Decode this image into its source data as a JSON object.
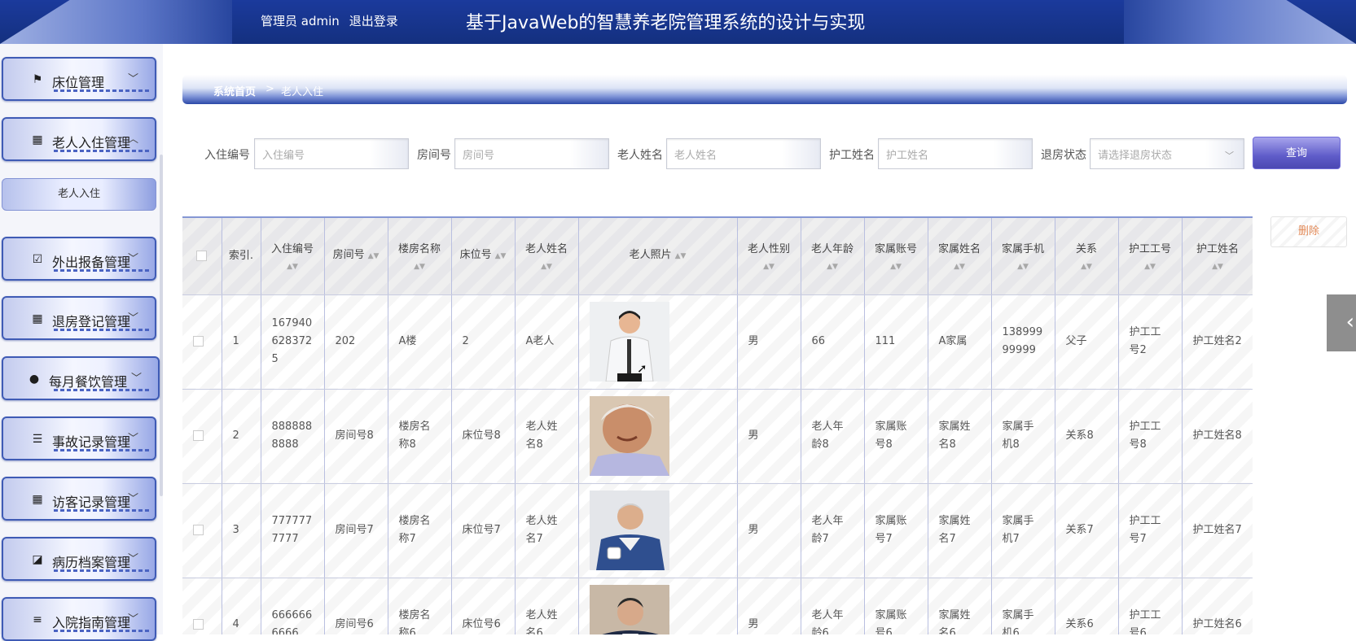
{
  "header": {
    "user_label": "管理员 admin",
    "logout": "退出登录",
    "title": "基于JavaWeb的智慧养老院管理系统的设计与实现"
  },
  "sidebar": {
    "menus": [
      {
        "label": "床位管理",
        "icon": "flag-icon",
        "chevron": "﹀"
      },
      {
        "label": "老人入住管理",
        "icon": "grid-icon",
        "chevron": "︿"
      },
      {
        "label": "外出报备管理",
        "icon": "clipboard-check-icon",
        "chevron": "﹀"
      },
      {
        "label": "退房登记管理",
        "icon": "grid-icon",
        "chevron": "﹀"
      },
      {
        "label": "每月餐饮管理",
        "icon": "lightbulb-icon",
        "chevron": "﹀"
      },
      {
        "label": "事故记录管理",
        "icon": "sliders-icon",
        "chevron": "﹀"
      },
      {
        "label": "访客记录管理",
        "icon": "grid-icon",
        "chevron": "﹀"
      },
      {
        "label": "病历档案管理",
        "icon": "chart-icon",
        "chevron": "﹀"
      },
      {
        "label": "入院指南管理",
        "icon": "list-icon",
        "chevron": "﹀"
      }
    ],
    "submenu": {
      "label": "老人入住"
    }
  },
  "breadcrumb": {
    "home": "系统首页",
    "sep": ">",
    "current": "老人入住"
  },
  "search": {
    "fields": [
      {
        "label": "入住编号",
        "placeholder": "入住编号"
      },
      {
        "label": "房间号",
        "placeholder": "房间号"
      },
      {
        "label": "老人姓名",
        "placeholder": "老人姓名"
      },
      {
        "label": "护工姓名",
        "placeholder": "护工姓名"
      },
      {
        "label": "退房状态",
        "placeholder": "请选择退房状态"
      }
    ],
    "query_button": "查询"
  },
  "actions": {
    "delete_button": "删除"
  },
  "table": {
    "headers": {
      "index": "索引.",
      "checkin_no": "入住编号",
      "room_no": "房间号",
      "building": "楼房名称",
      "bed_no": "床位号",
      "elder_name": "老人姓名",
      "photo": "老人照片",
      "gender": "老人性别",
      "age": "老人年龄",
      "family_account": "家属账号",
      "family_name": "家属姓名",
      "family_phone": "家属手机",
      "relation": "关系",
      "nurse_no": "护工工号",
      "nurse_name": "护工姓名"
    },
    "rows": [
      {
        "index": "1",
        "checkin_no": "1679406283725",
        "room_no": "202",
        "building": "A楼",
        "bed_no": "2",
        "elder_name": "A老人",
        "gender": "男",
        "age": "66",
        "family_account": "111",
        "family_name": "A家属",
        "family_phone": "13899999999",
        "relation": "父子",
        "nurse_no": "护工工号2",
        "nurse_name": "护工姓名2"
      },
      {
        "index": "2",
        "checkin_no": "8888888888",
        "room_no": "房间号8",
        "building": "楼房名称8",
        "bed_no": "床位号8",
        "elder_name": "老人姓名8",
        "gender": "男",
        "age": "老人年龄8",
        "family_account": "家属账号8",
        "family_name": "家属姓名8",
        "family_phone": "家属手机8",
        "relation": "关系8",
        "nurse_no": "护工工号8",
        "nurse_name": "护工姓名8"
      },
      {
        "index": "3",
        "checkin_no": "7777777777",
        "room_no": "房间号7",
        "building": "楼房名称7",
        "bed_no": "床位号7",
        "elder_name": "老人姓名7",
        "gender": "男",
        "age": "老人年龄7",
        "family_account": "家属账号7",
        "family_name": "家属姓名7",
        "family_phone": "家属手机7",
        "relation": "关系7",
        "nurse_no": "护工工号7",
        "nurse_name": "护工姓名7"
      },
      {
        "index": "4",
        "checkin_no": "6666666666",
        "room_no": "房间号6",
        "building": "楼房名称6",
        "bed_no": "床位号6",
        "elder_name": "老人姓名6",
        "gender": "男",
        "age": "老人年龄6",
        "family_account": "家属账号6",
        "family_name": "家属姓名6",
        "family_phone": "家属手机6",
        "relation": "关系6",
        "nurse_no": "护工工号6",
        "nurse_name": "护工姓名6"
      }
    ]
  },
  "colors": {
    "header": "#1b3a9c",
    "accent": "#3f5bb5",
    "query": "#5f5cc9",
    "delete_text": "#e28a58"
  }
}
